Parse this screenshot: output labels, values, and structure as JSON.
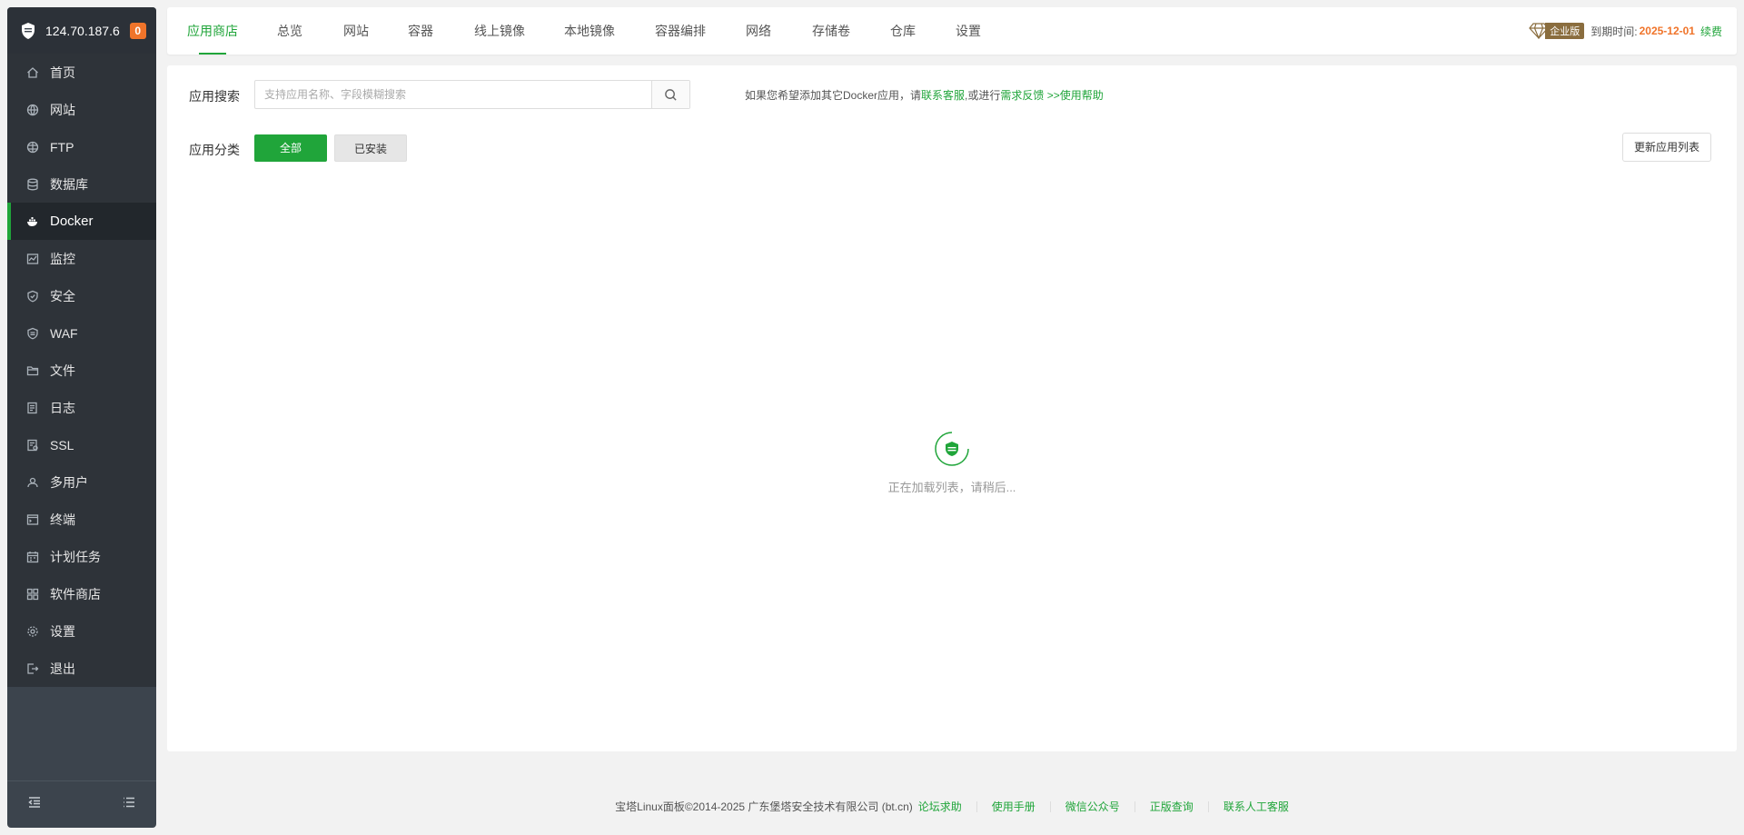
{
  "sidebar": {
    "ip": "124.70.187.6",
    "badge": "0",
    "items": [
      {
        "label": "首页",
        "icon": "home-icon"
      },
      {
        "label": "网站",
        "icon": "globe-icon"
      },
      {
        "label": "FTP",
        "icon": "ftp-icon"
      },
      {
        "label": "数据库",
        "icon": "database-icon"
      },
      {
        "label": "Docker",
        "icon": "docker-icon"
      },
      {
        "label": "监控",
        "icon": "monitor-icon"
      },
      {
        "label": "安全",
        "icon": "shield-icon"
      },
      {
        "label": "WAF",
        "icon": "waf-icon"
      },
      {
        "label": "文件",
        "icon": "folder-icon"
      },
      {
        "label": "日志",
        "icon": "log-icon"
      },
      {
        "label": "SSL",
        "icon": "ssl-icon"
      },
      {
        "label": "多用户",
        "icon": "users-icon"
      },
      {
        "label": "终端",
        "icon": "terminal-icon"
      },
      {
        "label": "计划任务",
        "icon": "calendar-icon"
      },
      {
        "label": "软件商店",
        "icon": "grid-icon"
      },
      {
        "label": "设置",
        "icon": "gear-icon"
      },
      {
        "label": "退出",
        "icon": "logout-icon"
      }
    ]
  },
  "topnav": {
    "tabs": [
      "应用商店",
      "总览",
      "网站",
      "容器",
      "线上镜像",
      "本地镜像",
      "容器编排",
      "网络",
      "存储卷",
      "仓库",
      "设置"
    ],
    "edition": "企业版",
    "expire_label": "到期时间:",
    "expire_date": "2025-12-01",
    "renew": "续费"
  },
  "main": {
    "search_label": "应用搜索",
    "search_placeholder": "支持应用名称、字段模糊搜索",
    "hint_prefix": "如果您希望添加其它Docker应用，请",
    "hint_link1": "联系客服",
    "hint_mid": ",或进行",
    "hint_link2": "需求反馈",
    "hint_link3": " >>使用帮助",
    "category_label": "应用分类",
    "cat_all": "全部",
    "cat_installed": "已安装",
    "refresh": "更新应用列表",
    "loading_text": "正在加载列表，请稍后..."
  },
  "footer": {
    "copyright": "宝塔Linux面板©2014-2025 广东堡塔安全技术有限公司 (bt.cn)",
    "links": [
      "论坛求助",
      "使用手册",
      "微信公众号",
      "正版查询",
      "联系人工客服"
    ]
  },
  "colors": {
    "accent": "#20a53a",
    "sidebar_bg": "#3c444d",
    "orange": "#f0742a"
  }
}
